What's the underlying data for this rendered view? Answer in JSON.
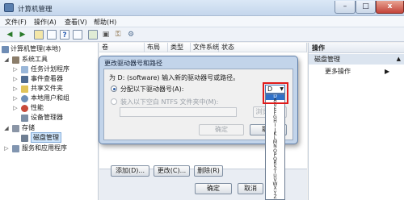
{
  "window": {
    "title": "计算机管理",
    "controls": {
      "min": "–",
      "max": "□",
      "close": "x"
    }
  },
  "menu": [
    "文件(F)",
    "操作(A)",
    "查看(V)",
    "帮助(H)"
  ],
  "toolbar": {
    "back_icon": "left-arrow-icon",
    "forward_icon": "right-arrow-icon",
    "buttons": [
      "up-folder-icon",
      "show-tree-icon",
      "help-icon",
      "properties-icon",
      "refresh-icon",
      "export-icon",
      "console-icon",
      "key-icon",
      "settings-icon",
      "view-icon"
    ]
  },
  "tree": [
    {
      "label": "计算机管理(本地)",
      "twisty": ""
    },
    {
      "label": "系统工具",
      "twisty": "◢"
    },
    {
      "label": "任务计划程序",
      "twisty": "▷"
    },
    {
      "label": "事件查看器",
      "twisty": "▷"
    },
    {
      "label": "共享文件夹",
      "twisty": "▷"
    },
    {
      "label": "本地用户和组",
      "twisty": "▷"
    },
    {
      "label": "性能",
      "twisty": "▷"
    },
    {
      "label": "设备管理器",
      "twisty": ""
    },
    {
      "label": "存储",
      "twisty": "◢"
    },
    {
      "label": "磁盘管理",
      "twisty": ""
    },
    {
      "label": "服务和应用程序",
      "twisty": "▷"
    }
  ],
  "columns": [
    "卷",
    "布局",
    "类型",
    "文件系统",
    "状态"
  ],
  "actions": {
    "header": "操作",
    "section": "磁盘管理",
    "more": "更多操作",
    "caret": "▲",
    "arrow": "▶"
  },
  "dialog": {
    "title": "更改驱动器号和路径",
    "prompt": "为 D: (software) 输入新的驱动器号或路径。",
    "option_letter": "分配以下驱动器号(A):",
    "option_folder": "装入以下空白 NTFS 文件夹中(M):",
    "browse": "浏览(B)...",
    "ok": "确定",
    "cancel": "取消"
  },
  "drive_combo": {
    "selected": "D",
    "arrow": "▼",
    "options": [
      "D",
      "A",
      "B",
      "E",
      "F",
      "G",
      "H",
      "I",
      "J",
      "K",
      "L",
      "M",
      "N",
      "O",
      "P",
      "Q",
      "R",
      "S",
      "T",
      "U",
      "V",
      "W",
      "X",
      "Y",
      "Z"
    ]
  },
  "lower_dialog": {
    "add": "添加(D)...",
    "change": "更改(C)...",
    "remove": "删除(R)",
    "ok": "确定",
    "cancel": "取消"
  },
  "colors": {
    "accent": "#3070c8",
    "highlight_border": "#e01a1a",
    "selection": "#cde4fb"
  }
}
